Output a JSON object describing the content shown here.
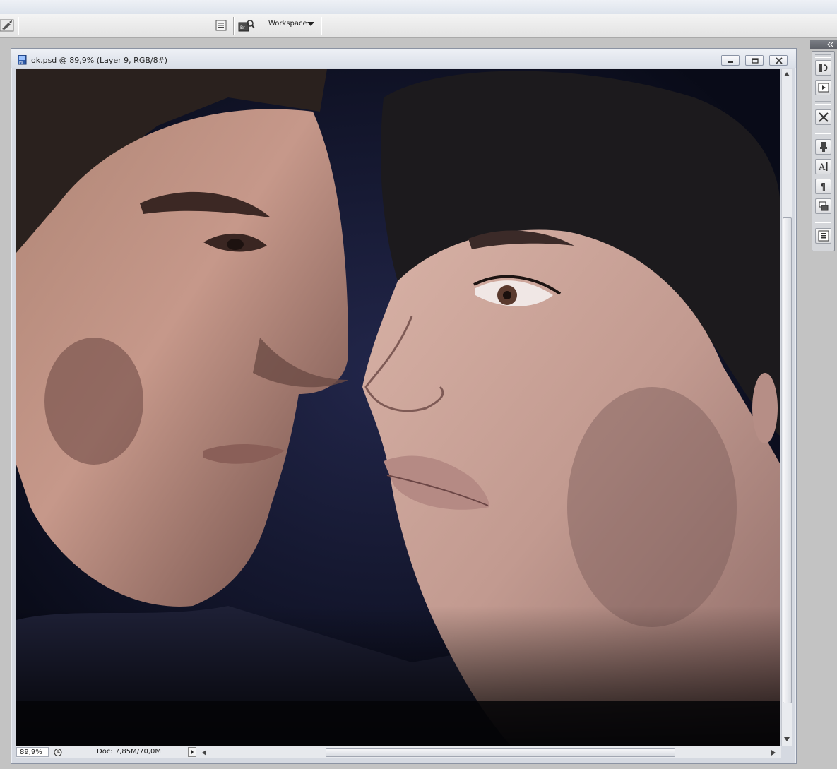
{
  "options_bar": {
    "workspace_label": "Workspace",
    "icons": [
      "brush-preset-icon",
      "palette-well-icon",
      "bridge-browse-icon",
      "workspace-dropdown-icon"
    ]
  },
  "document": {
    "title": "ok.psd @ 89,9% (Layer 9, RGB/8#)",
    "zoom": "89,9%",
    "doc_info": "Doc: 7,85M/70,0M",
    "window_controls": [
      "minimize-icon",
      "restore-icon",
      "close-icon"
    ]
  },
  "dock": {
    "icons": [
      "history-icon",
      "actions-icon",
      "tool-presets-icon",
      "clone-source-icon",
      "character-icon",
      "paragraph-icon",
      "layer-comps-icon",
      "notes-icon"
    ]
  },
  "colors": {
    "canvas_background": "#0f1225",
    "window_chrome": "#d5d9e1",
    "app_background": "#c3c3c3"
  }
}
